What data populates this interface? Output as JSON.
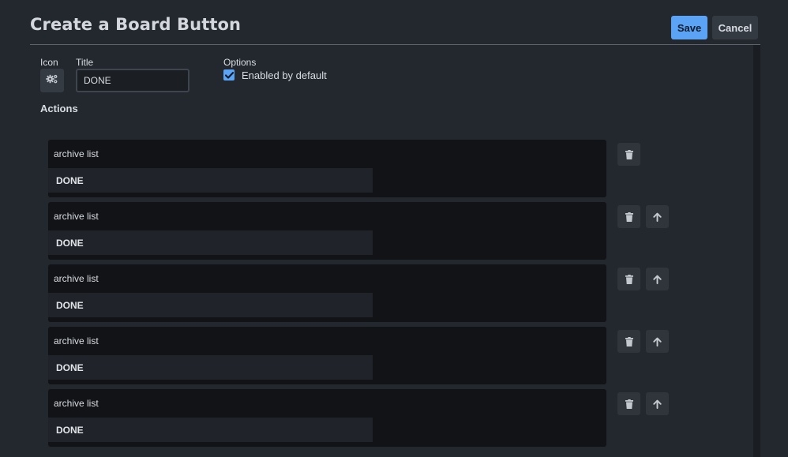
{
  "header": {
    "title": "Create a Board Button",
    "save_label": "Save",
    "cancel_label": "Cancel"
  },
  "form": {
    "icon_label": "Icon",
    "icon_name": "gear-icon",
    "title_label": "Title",
    "title_value": "DONE",
    "options_label": "Options",
    "enabled_label": "Enabled by default",
    "enabled_checked": true,
    "actions_heading": "Actions"
  },
  "actions": [
    {
      "type": "archive list",
      "param": "DONE"
    },
    {
      "type": "archive list",
      "param": "DONE"
    },
    {
      "type": "archive list",
      "param": "DONE"
    },
    {
      "type": "archive list",
      "param": "DONE"
    },
    {
      "type": "archive list",
      "param": "DONE"
    }
  ],
  "colors": {
    "background": "#23272e",
    "accent": "#5aa3f5",
    "card": "#111316"
  }
}
